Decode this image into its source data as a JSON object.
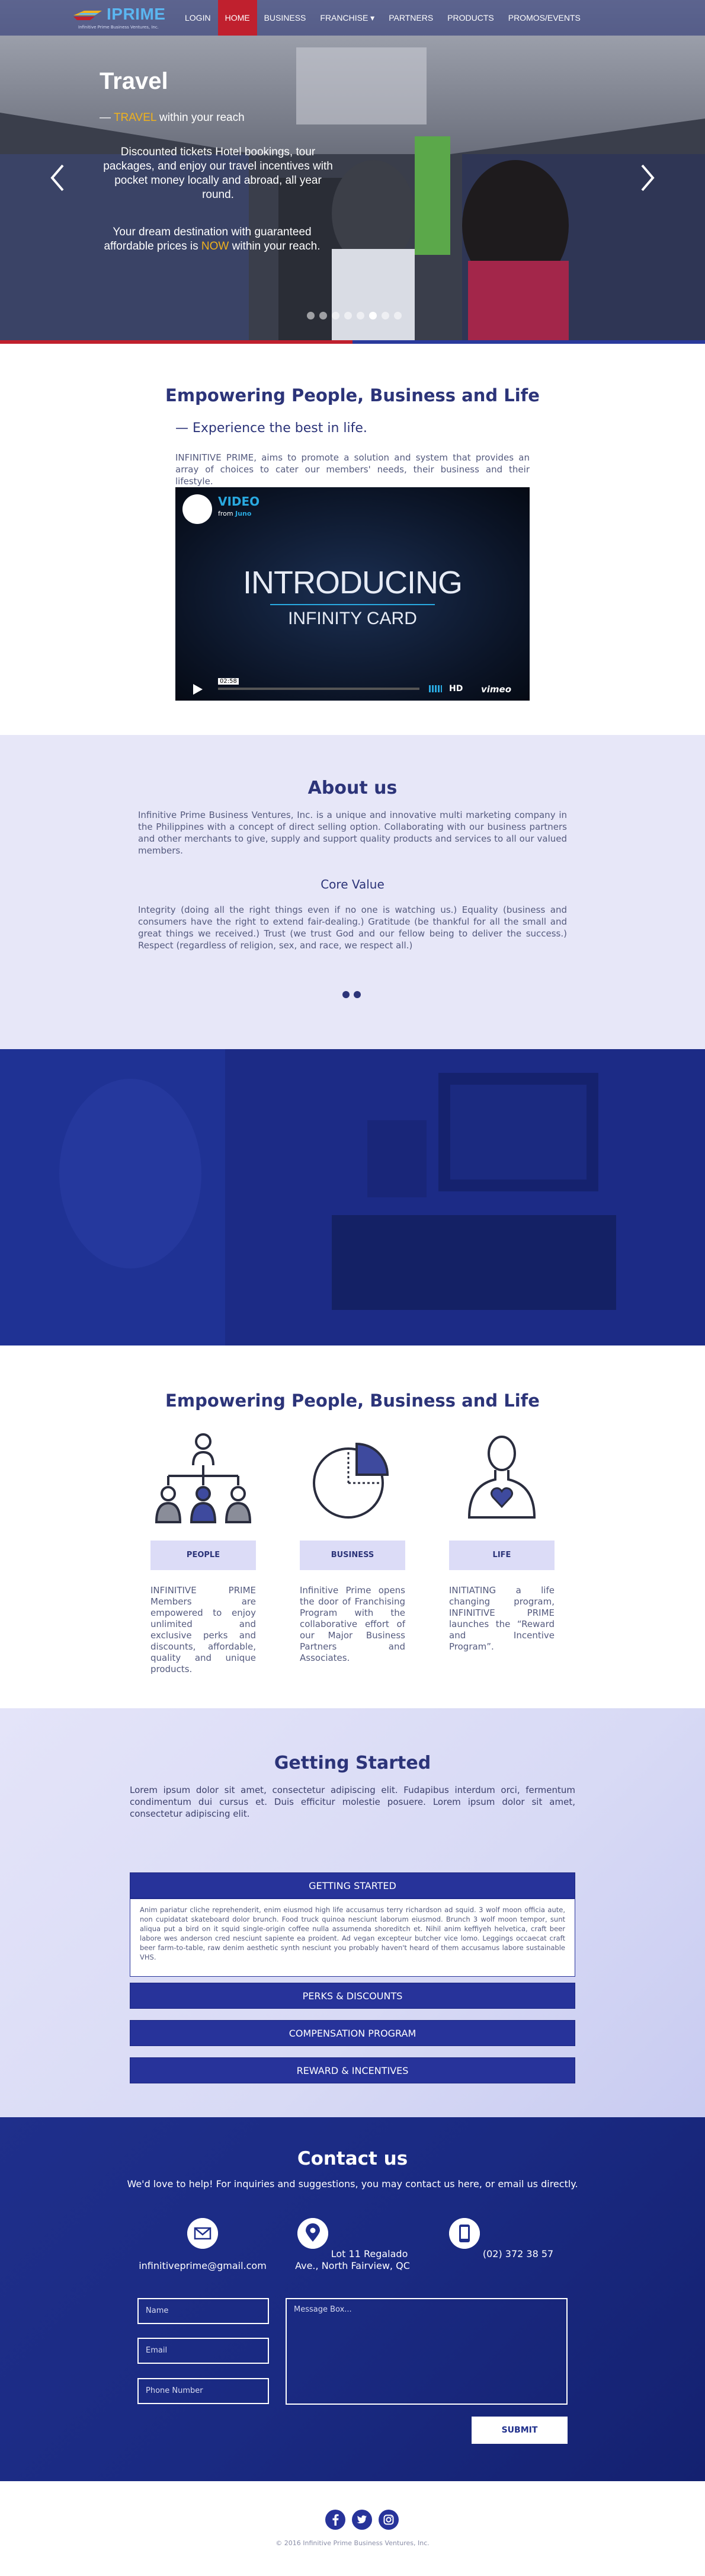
{
  "nav": {
    "logo_text": "IPRIME",
    "logo_tagline": "Infinitive Prime Business Ventures, Inc.",
    "items": [
      {
        "label": "LOGIN"
      },
      {
        "label": "HOME"
      },
      {
        "label": "BUSINESS"
      },
      {
        "label": "FRANCHISE ▾"
      },
      {
        "label": "PARTNERS"
      },
      {
        "label": "PRODUCTS"
      },
      {
        "label": "PROMOS/EVENTS"
      }
    ],
    "active_index": 1
  },
  "hero": {
    "title": "Travel",
    "sub_prefix": "— ",
    "sub_highlight": "TRAVEL",
    "sub_suffix": " within your reach",
    "paragraph1": "Discounted tickets Hotel bookings, tour packages, and enjoy our travel incentives with pocket money locally and abroad, all year round.",
    "paragraph2_a": "Your dream destination with guaranteed affordable prices is ",
    "paragraph2_hl": "NOW",
    "paragraph2_b": " within your reach.",
    "slide_count": 8,
    "active_slide": 5
  },
  "intro": {
    "heading": "Empowering People, Business and Life",
    "subheading": "— Experience the best in life.",
    "text": "INFINITIVE PRIME, aims to promote a solution and system that provides an array of choices to cater our members' needs, their business and their lifestyle.",
    "video": {
      "label": "VIDEO",
      "from_prefix": "from ",
      "from_name": "Juno",
      "title_line1": "INTRODUCING",
      "title_line2": "INFINITY CARD",
      "time": "02:58",
      "hd": "HD",
      "brand": "vimeo"
    }
  },
  "about": {
    "heading": "About us",
    "text": "Infinitive Prime Business Ventures, Inc. is a unique and innovative multi marketing company in the Philippines with a concept of direct selling option. Collaborating with our business partners and other merchants to give, supply and support quality products and services to all our valued members.",
    "core_heading": "Core Value",
    "core_text": "Integrity (doing all the right things even if no one is watching us.) Equality (business and consumers have the right to extend fair-dealing.) Gratitude (be thankful for all the small and great things we received.) Trust (we trust God and our fellow being to deliver the success.) Respect (regardless of religion, sex, and race, we respect all.)"
  },
  "features": {
    "heading": "Empowering People, Business and Life",
    "items": [
      {
        "label": "PEOPLE",
        "text": "INFINITIVE PRIME Members are empowered to enjoy unlimited and exclusive perks and discounts, affordable, quality and unique products."
      },
      {
        "label": "BUSINESS",
        "text": "Infinitive Prime opens the door of Franchising Program with the collaborative effort of our Major Business Partners and Associates."
      },
      {
        "label": "LIFE",
        "text": "INITIATING a life changing program, INFINITIVE PRIME launches the “Reward and Incentive Program”."
      }
    ]
  },
  "getting_started": {
    "heading": "Getting Started",
    "text": "Lorem ipsum dolor sit amet, consectetur adipiscing elit. Fudapibus interdum orci, fermentum condimentum dui cursus et. Duis efficitur molestie posuere. Lorem ipsum dolor sit amet, consectetur adipiscing elit.",
    "panels": [
      {
        "label": "GETTING STARTED"
      },
      {
        "label": "PERKS & DISCOUNTS"
      },
      {
        "label": "COMPENSATION PROGRAM"
      },
      {
        "label": "REWARD & INCENTIVES"
      }
    ],
    "open_panel_text": "Anim pariatur cliche reprehenderit, enim eiusmod high life accusamus terry richardson ad squid. 3 wolf moon officia aute, non cupidatat skateboard dolor brunch. Food truck quinoa nesciunt laborum eiusmod. Brunch 3 wolf moon tempor, sunt aliqua put a bird on it squid single-origin coffee nulla assumenda shoreditch et. Nihil anim keffiyeh helvetica, craft beer labore wes anderson cred nesciunt sapiente ea proident. Ad vegan excepteur butcher vice lomo. Leggings occaecat craft beer farm-to-table, raw denim aesthetic synth nesciunt you probably haven't heard of them accusamus labore sustainable VHS."
  },
  "contact": {
    "heading": "Contact us",
    "text": "We'd love to help! For inquiries and suggestions, you may contact us here, or email us directly.",
    "email": "infinitiveprime@gmail.com",
    "address": "Lot 11 Regalado Ave., North Fairview, QC",
    "phone": "(02) 372 38 57",
    "form": {
      "name_placeholder": "Name",
      "email_placeholder": "Email",
      "phone_placeholder": "Phone Number",
      "message_placeholder": "Message Box...",
      "submit": "SUBMIT"
    }
  },
  "footer": {
    "social": [
      "facebook-icon",
      "twitter-icon",
      "instagram-icon"
    ],
    "copyright": "© 2016 Infinitive Prime Business Ventures, Inc."
  },
  "colors": {
    "brand_blue": "#27339a",
    "accent_red": "#c0202e",
    "highlight_yellow": "#f0b21c",
    "light_lavender": "#e7e7f8"
  }
}
